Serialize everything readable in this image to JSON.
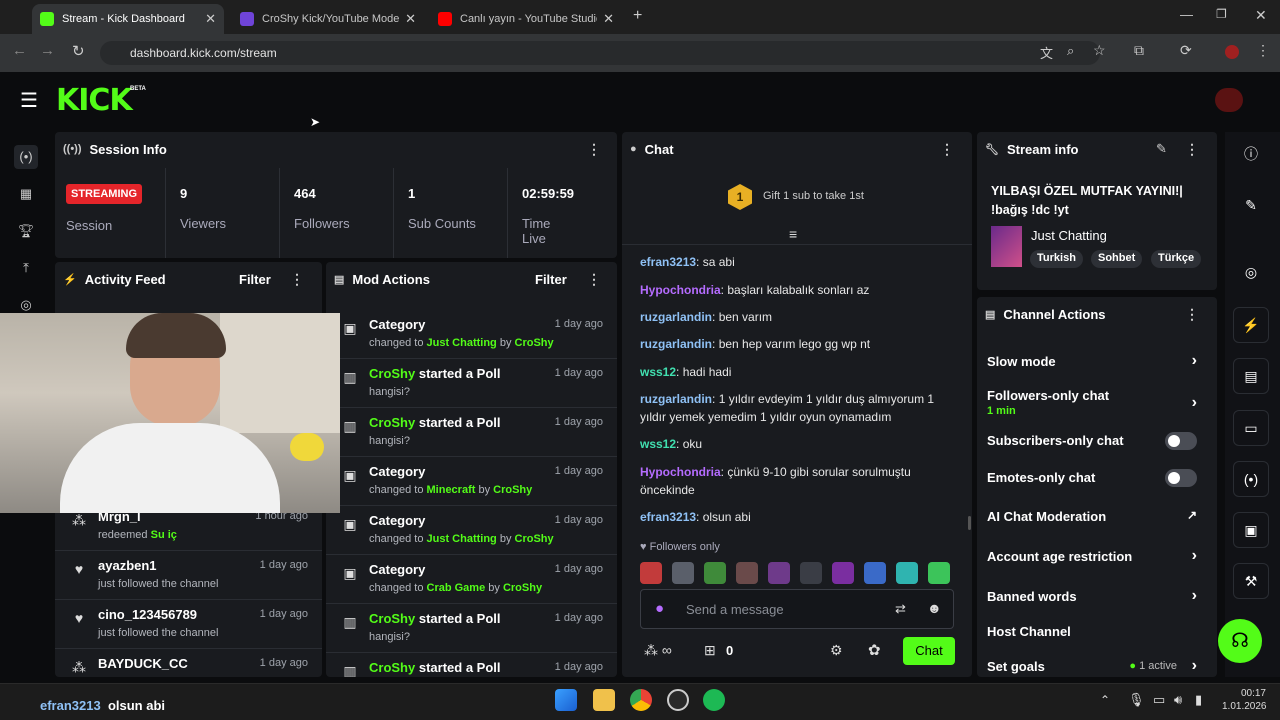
{
  "browser": {
    "tabs": [
      {
        "title": "Stream - Kick Dashboard",
        "active": true
      },
      {
        "title": "CroShy Kick/YouTube Moderat",
        "active": false
      },
      {
        "title": "Canlı yayın - YouTube Studio",
        "active": false
      }
    ],
    "url": "dashboard.kick.com/stream"
  },
  "app": {
    "logo": "KICK",
    "beta": "BETA"
  },
  "session": {
    "title": "Session Info",
    "badge": "STREAMING",
    "badge_label": "Session",
    "stats": [
      {
        "value": "9",
        "label": "Viewers"
      },
      {
        "value": "464",
        "label": "Followers"
      },
      {
        "value": "1",
        "label": "Sub Counts"
      },
      {
        "value": "02:59:59",
        "label": "Time Live"
      }
    ]
  },
  "activity": {
    "title": "Activity Feed",
    "filter": "Filter",
    "items": [
      {
        "user": "Mrgn_l",
        "action": "redeemed",
        "extra": "Su iç",
        "ago": "1 hour ago"
      },
      {
        "user": "ayazben1",
        "action": "just followed the channel",
        "ago": "1 day ago"
      },
      {
        "user": "cino_123456789",
        "action": "just followed the channel",
        "ago": "1 day ago"
      },
      {
        "user": "BAYDUCK_CC",
        "action": "",
        "ago": "1 day ago"
      }
    ]
  },
  "mod": {
    "title": "Mod Actions",
    "filter": "Filter",
    "items": [
      {
        "title": "Category",
        "pre": "changed to",
        "target": "Just Chatting",
        "by": "by",
        "user": "CroShy",
        "ago": "1 day ago"
      },
      {
        "user": "CroShy",
        "title": "started a Poll",
        "sub": "hangisi?",
        "ago": "1 day ago"
      },
      {
        "user": "CroShy",
        "title": "started a Poll",
        "sub": "hangisi?",
        "ago": "1 day ago"
      },
      {
        "title": "Category",
        "pre": "changed to",
        "target": "Minecraft",
        "by": "by",
        "user": "CroShy",
        "ago": "1 day ago"
      },
      {
        "title": "Category",
        "pre": "changed to",
        "target": "Just Chatting",
        "by": "by",
        "user": "CroShy",
        "ago": "1 day ago"
      },
      {
        "title": "Category",
        "pre": "changed to",
        "target": "Crab Game",
        "by": "by",
        "user": "CroShy",
        "ago": "1 day ago"
      },
      {
        "user": "CroShy",
        "title": "started a Poll",
        "sub": "hangisi?",
        "ago": "1 day ago"
      },
      {
        "user": "CroShy",
        "title": "started a Poll",
        "sub": "",
        "ago": "1 day ago"
      }
    ]
  },
  "chat": {
    "title": "Chat",
    "gift": "Gift 1 sub to take 1st",
    "gift_num": "1",
    "messages": [
      {
        "user": "efran3213",
        "text": "sa abi",
        "color": "blue"
      },
      {
        "user": "Hypochondria",
        "text": "başları kalabalık sonları az",
        "color": "purple"
      },
      {
        "user": "ruzgarlandin",
        "text": "ben varım",
        "color": "blue"
      },
      {
        "user": "ruzgarlandin",
        "text": "ben hep varım lego gg wp nt",
        "color": "blue"
      },
      {
        "user": "wss12",
        "text": "hadi hadi",
        "color": "teal"
      },
      {
        "user": "ruzgarlandin",
        "text": "1 yıldır evdeyim 1 yıldır duş almıyorum 1 yıldır yemek yemedim 1 yıldır oyun oynamadım",
        "color": "blue"
      },
      {
        "user": "wss12",
        "text": "oku",
        "color": "teal"
      },
      {
        "user": "Hypochondria",
        "text": "çünkü 9-10 gibi sorular sorulmuştu öncekinde",
        "color": "purple"
      },
      {
        "user": "efran3213",
        "text": "olsun abi",
        "color": "blue"
      }
    ],
    "followers_only": "Followers only",
    "placeholder": "Send a message",
    "count": "0",
    "send": "Chat"
  },
  "stream_info": {
    "title": "Stream info",
    "stream_title": "YILBAŞI ÖZEL MUTFAK YAYINI!| !bağış !dc !yt",
    "category": "Just Chatting",
    "tags": [
      "Turkish",
      "Sohbet",
      "Türkçe"
    ]
  },
  "channel_actions": {
    "title": "Channel Actions",
    "slow": "Slow mode",
    "followers": "Followers-only chat",
    "followers_sub": "1 min",
    "subs": "Subscribers-only chat",
    "emotes": "Emotes-only chat",
    "ai": "AI Chat Moderation",
    "age": "Account age restriction",
    "banned": "Banned words",
    "host": "Host Channel",
    "goals": "Set goals",
    "goals_status": "1 active"
  },
  "overlay": {
    "user": "efran3213",
    "text": "olsun abi"
  },
  "clock": {
    "time": "00:17",
    "date": "1.01.2026"
  },
  "colors": {
    "accent": "#53fc18",
    "streaming": "#e5252a",
    "panel": "#191b1f"
  }
}
